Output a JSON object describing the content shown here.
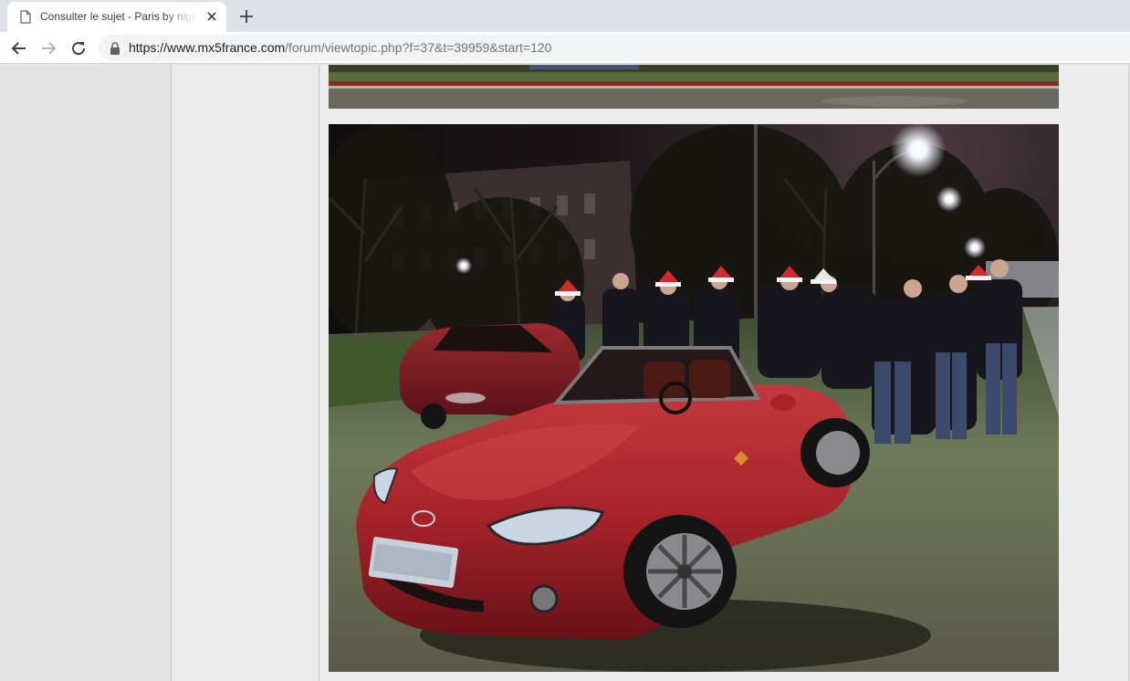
{
  "browser": {
    "tab_title": "Consulter le sujet - Paris by night",
    "url_host": "https://www.mx5france.com",
    "url_path": "/forum/viewtopic.php?f=37&t=39959&start=120"
  },
  "icons": {
    "tab": "document-icon",
    "close": "close-icon",
    "new_tab": "plus-icon",
    "back": "back-arrow-icon",
    "forward": "forward-arrow-icon",
    "reload": "reload-icon",
    "secure": "lock-icon"
  },
  "post": {
    "images": [
      {
        "description_alt": ""
      },
      {
        "description_alt": ""
      }
    ]
  },
  "colors": {
    "tabstrip": "#dee1e6",
    "omnibox": "#f1f3f4",
    "page_bg": "#e4e4e4",
    "car_red": "#a8232b"
  }
}
